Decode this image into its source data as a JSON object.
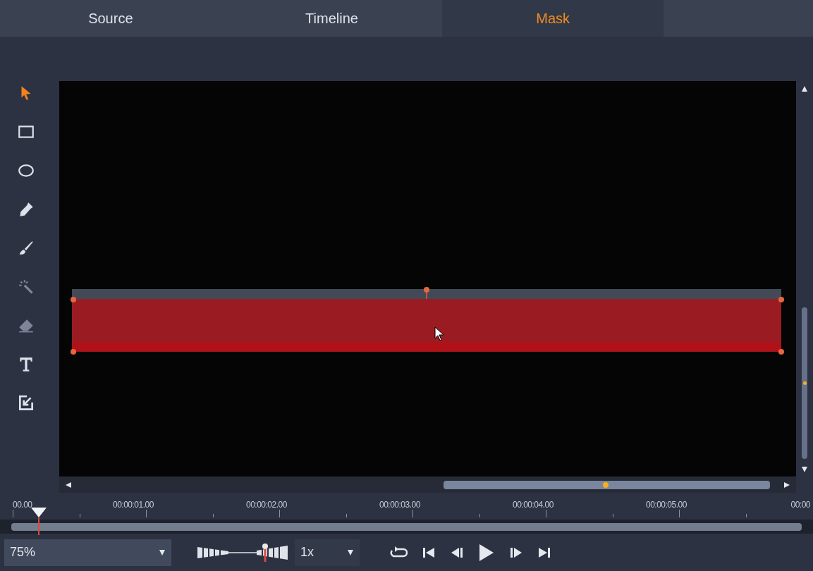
{
  "tabs": [
    {
      "label": "Source",
      "selected": false
    },
    {
      "label": "Timeline",
      "selected": false
    },
    {
      "label": "Mask",
      "selected": true
    }
  ],
  "tools": [
    {
      "kind": "pointer",
      "selected": true,
      "disabled": false
    },
    {
      "kind": "rectangle",
      "selected": false,
      "disabled": false
    },
    {
      "kind": "ellipse",
      "selected": false,
      "disabled": false
    },
    {
      "kind": "pen",
      "selected": false,
      "disabled": false
    },
    {
      "kind": "brush",
      "selected": false,
      "disabled": false
    },
    {
      "kind": "wand",
      "selected": false,
      "disabled": true
    },
    {
      "kind": "eraser",
      "selected": false,
      "disabled": true
    },
    {
      "kind": "text",
      "selected": false,
      "disabled": false
    },
    {
      "kind": "import",
      "selected": false,
      "disabled": false
    }
  ],
  "ruler": [
    "00.00",
    "00:00:01.00",
    "00:00:02.00",
    "00:00:03.00",
    "00:00:04.00",
    "00:00:05.00",
    "00:00"
  ],
  "zoom": {
    "value": "75%"
  },
  "speed": {
    "value": "1x"
  }
}
